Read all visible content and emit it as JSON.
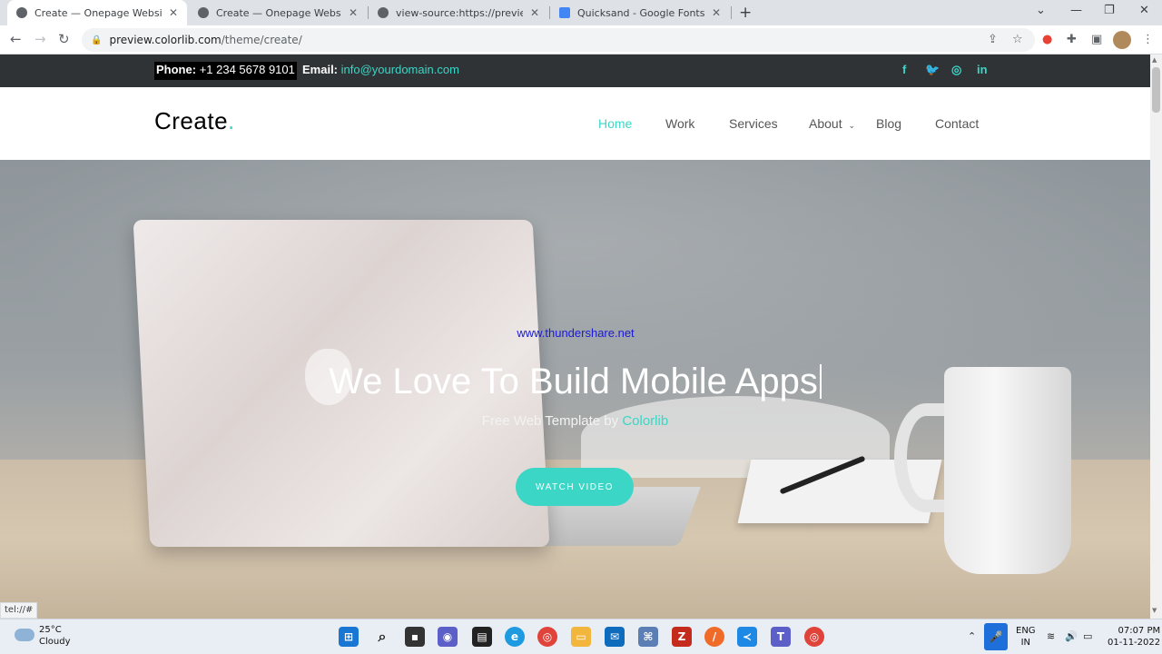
{
  "browser": {
    "tabs": [
      {
        "title": "Create — Onepage Website Tem",
        "favicon_color": "#5f6368"
      },
      {
        "title": "Create — Onepage Website Tem",
        "favicon_color": "#5f6368"
      },
      {
        "title": "view-source:https://preview.colo",
        "favicon_color": "#5f6368"
      },
      {
        "title": "Quicksand - Google Fonts",
        "favicon_color": "#4285f4"
      }
    ],
    "new_tab_icon": "+",
    "url_host": "preview.colorlib.com",
    "url_path": "/theme/create/"
  },
  "site": {
    "topbar": {
      "phone_label": "Phone:",
      "phone_value": "+1 234 5678 9101",
      "email_label": "Email:",
      "email_value": "info@yourdomain.com",
      "social_icons": [
        "facebook-icon",
        "twitter-icon",
        "instagram-icon",
        "linkedin-icon"
      ]
    },
    "logo": {
      "text": "Create",
      "dot": "."
    },
    "nav": [
      {
        "label": "Home",
        "active": true
      },
      {
        "label": "Work",
        "active": false
      },
      {
        "label": "Services",
        "active": false
      },
      {
        "label": "About",
        "active": false,
        "has_dropdown": true
      },
      {
        "label": "Blog",
        "active": false
      },
      {
        "label": "Contact",
        "active": false
      }
    ],
    "hero": {
      "watermark": "www.thundershare.net",
      "title": "We Love To Build Mobile Apps",
      "subtitle_prefix": "Free Web Template by",
      "subtitle_link": "Colorlib",
      "button": "WATCH VIDEO"
    },
    "accent_color": "#3bd6c6"
  },
  "status_bar": {
    "link": "tel://#"
  },
  "taskbar": {
    "weather_temp": "25°C",
    "weather_condition": "Cloudy",
    "language_top": "ENG",
    "language_bottom": "IN",
    "time": "07:07 PM",
    "date": "01-11-2022"
  }
}
